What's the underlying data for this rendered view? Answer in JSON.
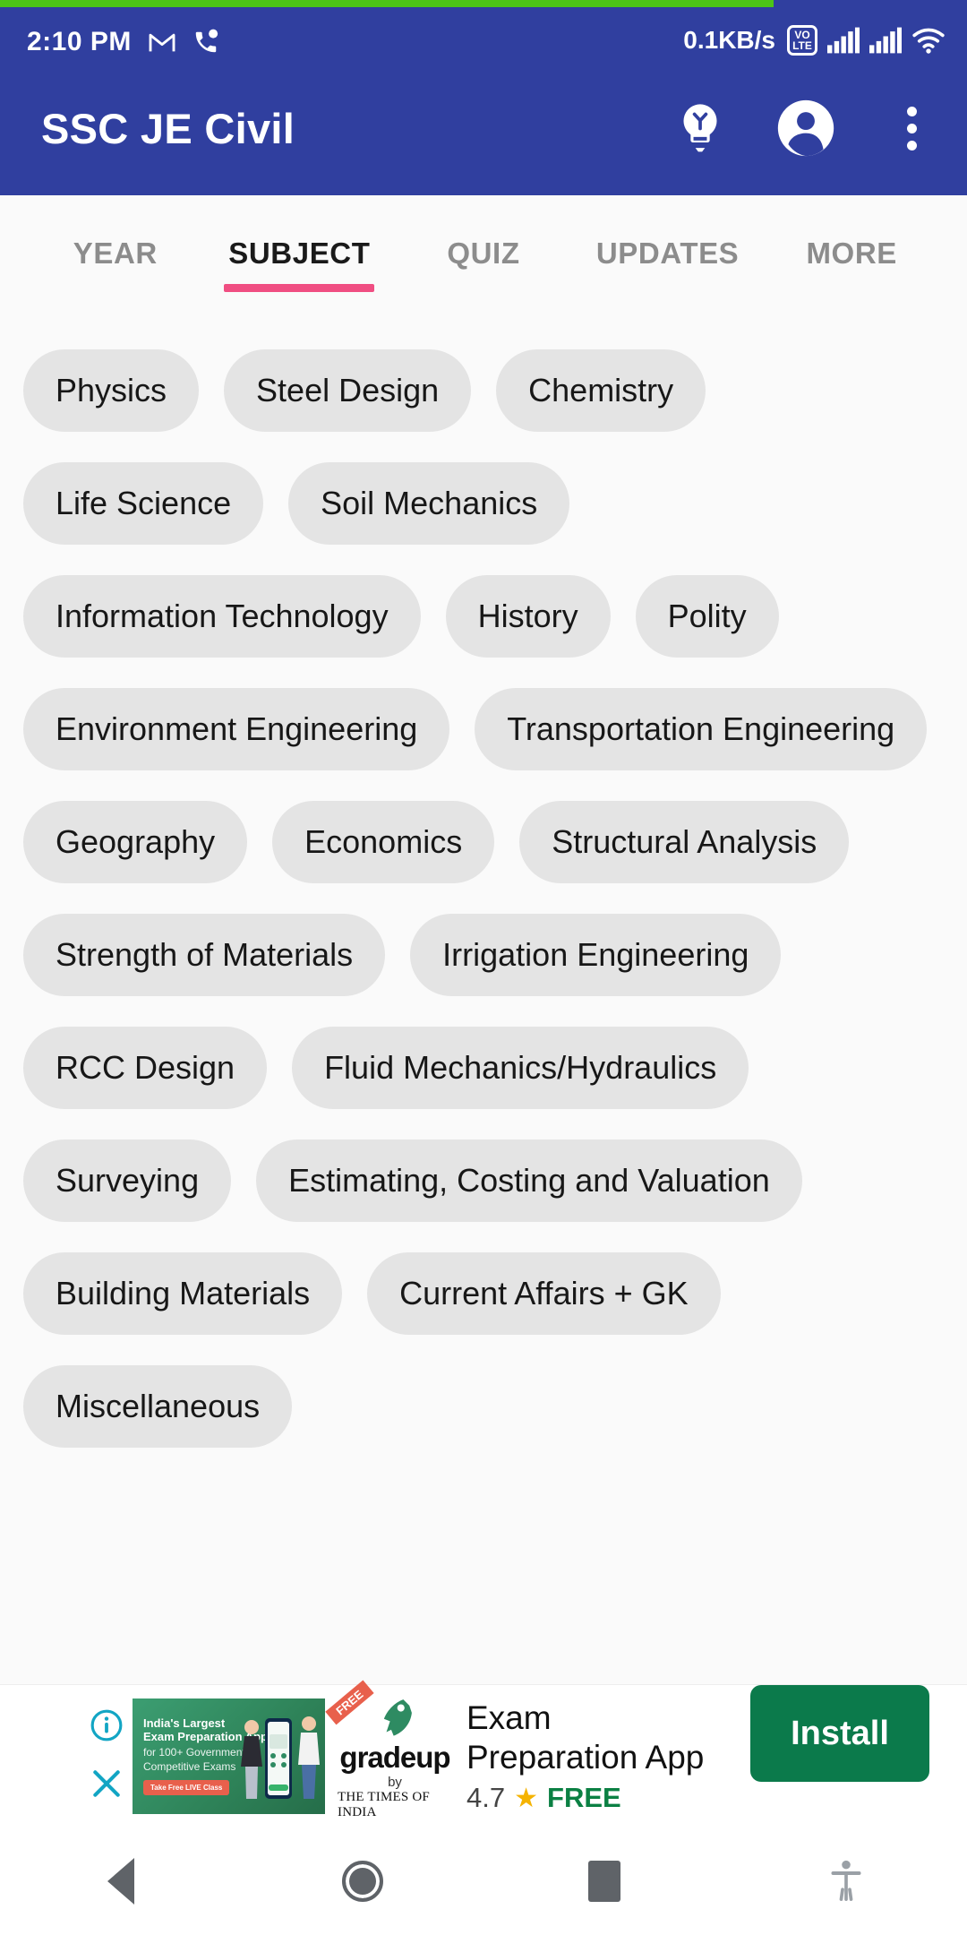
{
  "status_bar": {
    "time": "2:10 PM",
    "icons_left": [
      "gmail-icon",
      "call-icon"
    ],
    "net_speed": "0.1KB/s",
    "volte_top": "VO",
    "volte_bottom": "LTE",
    "icons_right": [
      "signal-1-icon",
      "signal-2-icon",
      "wifi-icon"
    ]
  },
  "progress": {
    "percent": 80,
    "color": "#4CC417"
  },
  "app_bar": {
    "title": "SSC JE Civil",
    "background": "#303F9F",
    "actions": [
      "lightbulb-icon",
      "account-icon",
      "overflow-menu-icon"
    ]
  },
  "tabs": {
    "items": [
      {
        "label": "YEAR",
        "active": false
      },
      {
        "label": "SUBJECT",
        "active": true
      },
      {
        "label": "QUIZ",
        "active": false
      },
      {
        "label": "UPDATES",
        "active": false
      },
      {
        "label": "MORE",
        "active": false
      }
    ],
    "indicator_color": "#F04E82"
  },
  "subjects": [
    "Physics",
    "Steel Design",
    "Chemistry",
    "Life Science",
    "Soil Mechanics",
    "Information Technology",
    "History",
    "Polity",
    "Environment Engineering",
    "Transportation Engineering",
    "Geography",
    "Economics",
    "Structural Analysis",
    "Strength of Materials",
    "Irrigation Engineering",
    "RCC Design",
    "Fluid Mechanics/Hydraulics",
    "Surveying",
    "Estimating, Costing and Valuation",
    "Building Materials",
    "Current Affairs + GK",
    "Miscellaneous"
  ],
  "ad": {
    "thumb_line1": "India's Largest",
    "thumb_line2": "Exam Preparation App",
    "thumb_line3": "for 100+ Government &",
    "thumb_line4": "Competitive Exams",
    "thumb_cta": "Take Free LIVE Class",
    "ribbon": "FREE",
    "logo_word": "gradeup",
    "logo_by": "by",
    "logo_publisher": "THE TIMES OF INDIA",
    "title_line1": "Exam",
    "title_line2": "Preparation App",
    "rating": "4.7",
    "price": "FREE",
    "install_label": "Install",
    "install_color": "#0B7A4B",
    "info_icon": "info-icon",
    "close_icon": "close-icon"
  },
  "nav_bar": {
    "back": "back-button",
    "home": "home-button",
    "recents": "recents-button",
    "accessibility": "accessibility-button"
  }
}
